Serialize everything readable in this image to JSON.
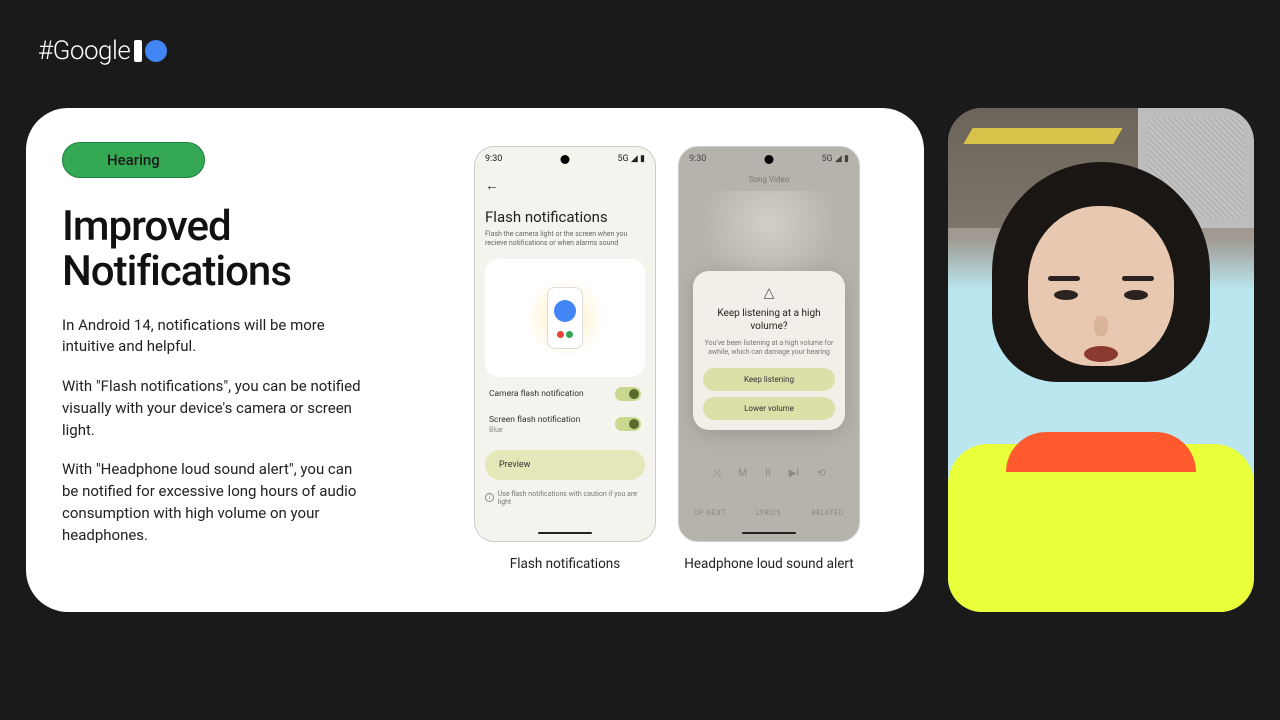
{
  "logo_text": "#Google",
  "pill_label": "Hearing",
  "title": "Improved Notifications",
  "para1": "In Android 14, notifications will be more intuitive and helpful.",
  "para2": "With \"Flash notifications\", you can be notified visually with your device's camera or screen light.",
  "para3": "With \"Headphone loud sound alert\", you can be notified for excessive long hours of audio consumption with high volume on your headphones.",
  "phone_time": "9:30",
  "phone_signal": "5G ◢ ▮",
  "phone1": {
    "screen_title": "Flash notifications",
    "screen_sub": "Flash the camera light or the screen when you recieve notifications or when alarms sound",
    "toggle1": "Camera flash notification",
    "toggle2": "Screen flash notification",
    "toggle2_sub": "Blue",
    "preview": "Preview",
    "info": "Use flash notifications with caution if you are light",
    "caption": "Flash notifications"
  },
  "phone2": {
    "tabs": "Song    Video",
    "dialog_title": "Keep listening at a high volume?",
    "dialog_sub": "You've been listening at a high volume for awhile, which can damage your hearing",
    "btn1": "Keep listening",
    "btn2": "Lower volume",
    "bottom1": "UP NEXT",
    "bottom2": "LYRICS",
    "bottom3": "RELATED",
    "caption": "Headphone loud sound alert"
  }
}
